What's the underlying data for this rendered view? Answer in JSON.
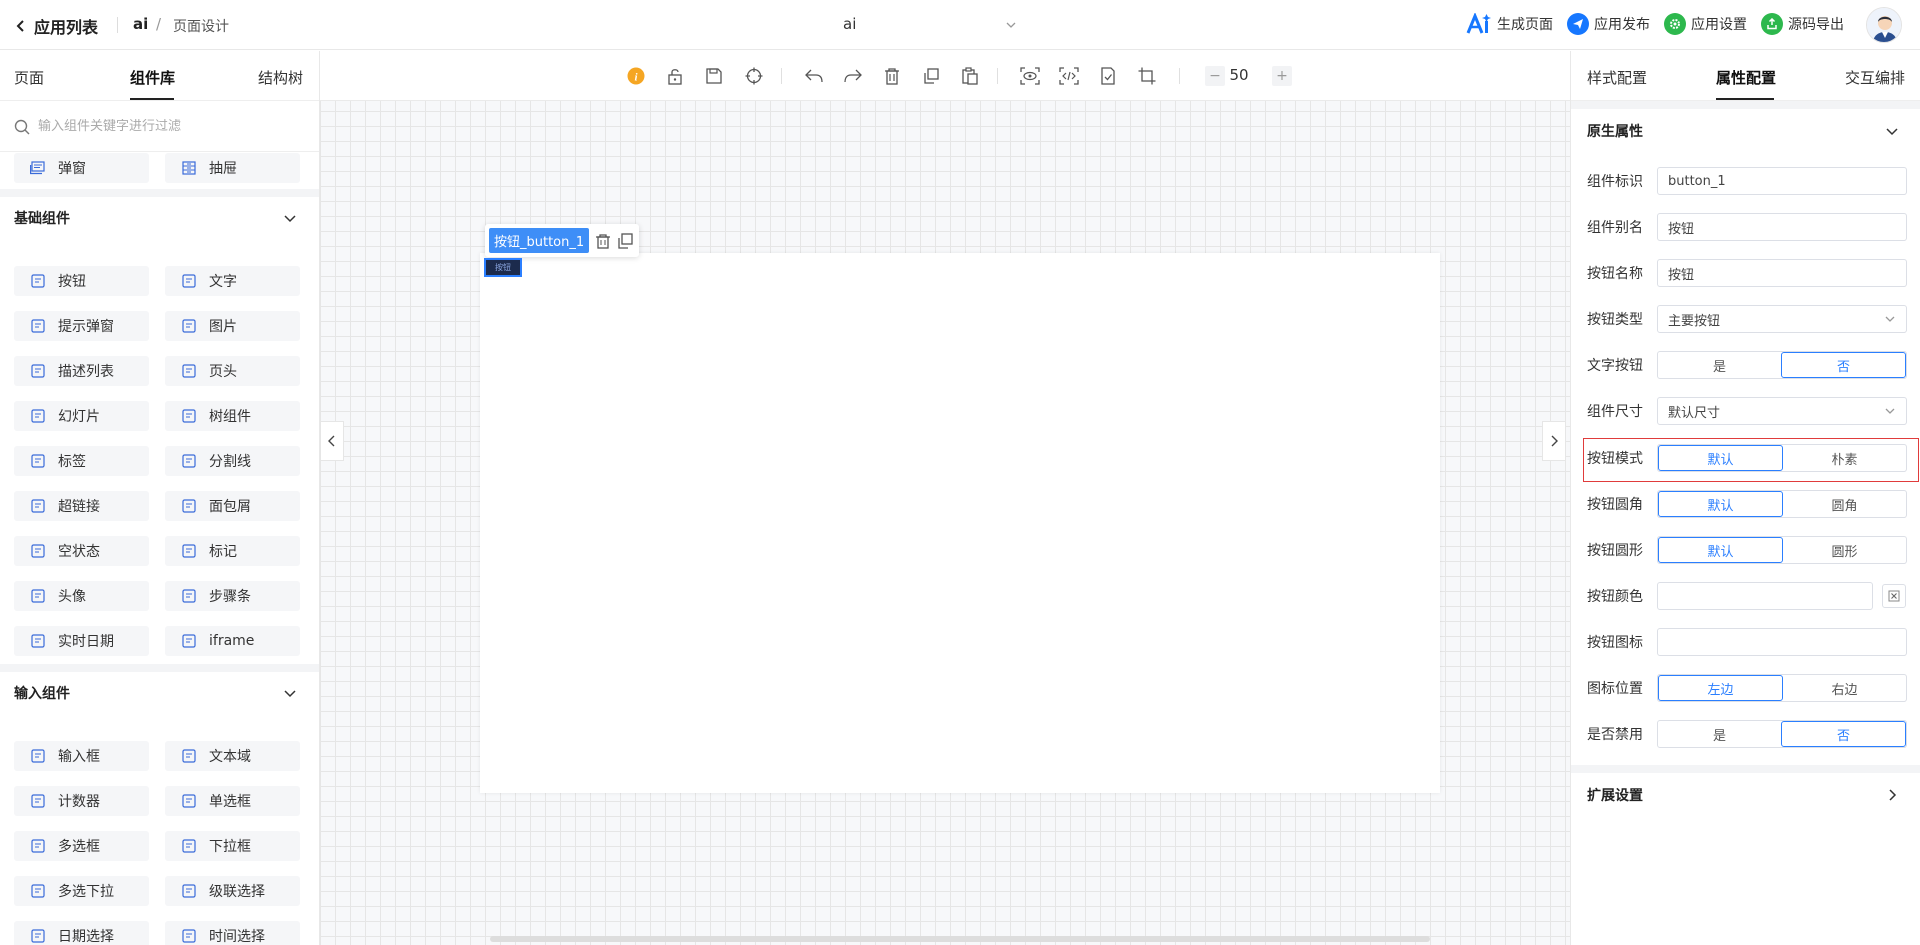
{
  "header": {
    "back_label": "应用列表",
    "app_name": "ai",
    "separator": "/",
    "crumb_page": "页面设计",
    "page_selected": "ai",
    "actions": [
      {
        "label": "生成页面",
        "icon": "ai-icon"
      },
      {
        "label": "应用发布",
        "icon": "paper-plane-icon",
        "color": "#1677ff"
      },
      {
        "label": "应用设置",
        "icon": "gear-icon",
        "color": "#2db84d"
      },
      {
        "label": "源码导出",
        "icon": "export-icon",
        "color": "#2db84d"
      }
    ]
  },
  "left": {
    "tabs": [
      "页面",
      "组件库",
      "结构树"
    ],
    "active_tab": "组件库",
    "search_placeholder": "输入组件关键字进行过滤",
    "top_items": [
      "弹窗",
      "抽屉"
    ],
    "groups": [
      {
        "title": "基础组件",
        "items": [
          "按钮",
          "文字",
          "提示弹窗",
          "图片",
          "描述列表",
          "页头",
          "幻灯片",
          "树组件",
          "标签",
          "分割线",
          "超链接",
          "面包屑",
          "空状态",
          "标记",
          "头像",
          "步骤条",
          "实时日期",
          "iframe"
        ]
      },
      {
        "title": "输入组件",
        "items": [
          "输入框",
          "文本域",
          "计数器",
          "单选框",
          "多选框",
          "下拉框",
          "多选下拉",
          "级联选择",
          "日期选择",
          "时间选择"
        ]
      }
    ]
  },
  "canvas": {
    "zoom": "50",
    "selected_label": "按钮_button_1",
    "selected_button_text": "按钮",
    "accent": "#2b7fff"
  },
  "right": {
    "tabs": [
      "样式配置",
      "属性配置",
      "交互编排"
    ],
    "active_tab": "属性配置",
    "section_native": "原生属性",
    "section_ext": "扩展设置",
    "props": {
      "component_id": {
        "label": "组件标识",
        "value": "button_1"
      },
      "component_alias": {
        "label": "组件别名",
        "value": "按钮"
      },
      "button_name": {
        "label": "按钮名称",
        "value": "按钮"
      },
      "button_type": {
        "label": "按钮类型",
        "value": "主要按钮"
      },
      "text_button": {
        "label": "文字按钮",
        "options": [
          "是",
          "否"
        ],
        "selected": "否"
      },
      "size": {
        "label": "组件尺寸",
        "value": "默认尺寸"
      },
      "mode": {
        "label": "按钮模式",
        "options": [
          "默认",
          "朴素"
        ],
        "selected": "默认"
      },
      "radius": {
        "label": "按钮圆角",
        "options": [
          "默认",
          "圆角"
        ],
        "selected": "默认"
      },
      "circle": {
        "label": "按钮圆形",
        "options": [
          "默认",
          "圆形"
        ],
        "selected": "默认"
      },
      "color": {
        "label": "按钮颜色",
        "value": ""
      },
      "icon": {
        "label": "按钮图标",
        "value": ""
      },
      "icon_pos": {
        "label": "图标位置",
        "options": [
          "左边",
          "右边"
        ],
        "selected": "左边"
      },
      "disabled": {
        "label": "是否禁用",
        "options": [
          "是",
          "否"
        ],
        "selected": "否"
      }
    }
  }
}
